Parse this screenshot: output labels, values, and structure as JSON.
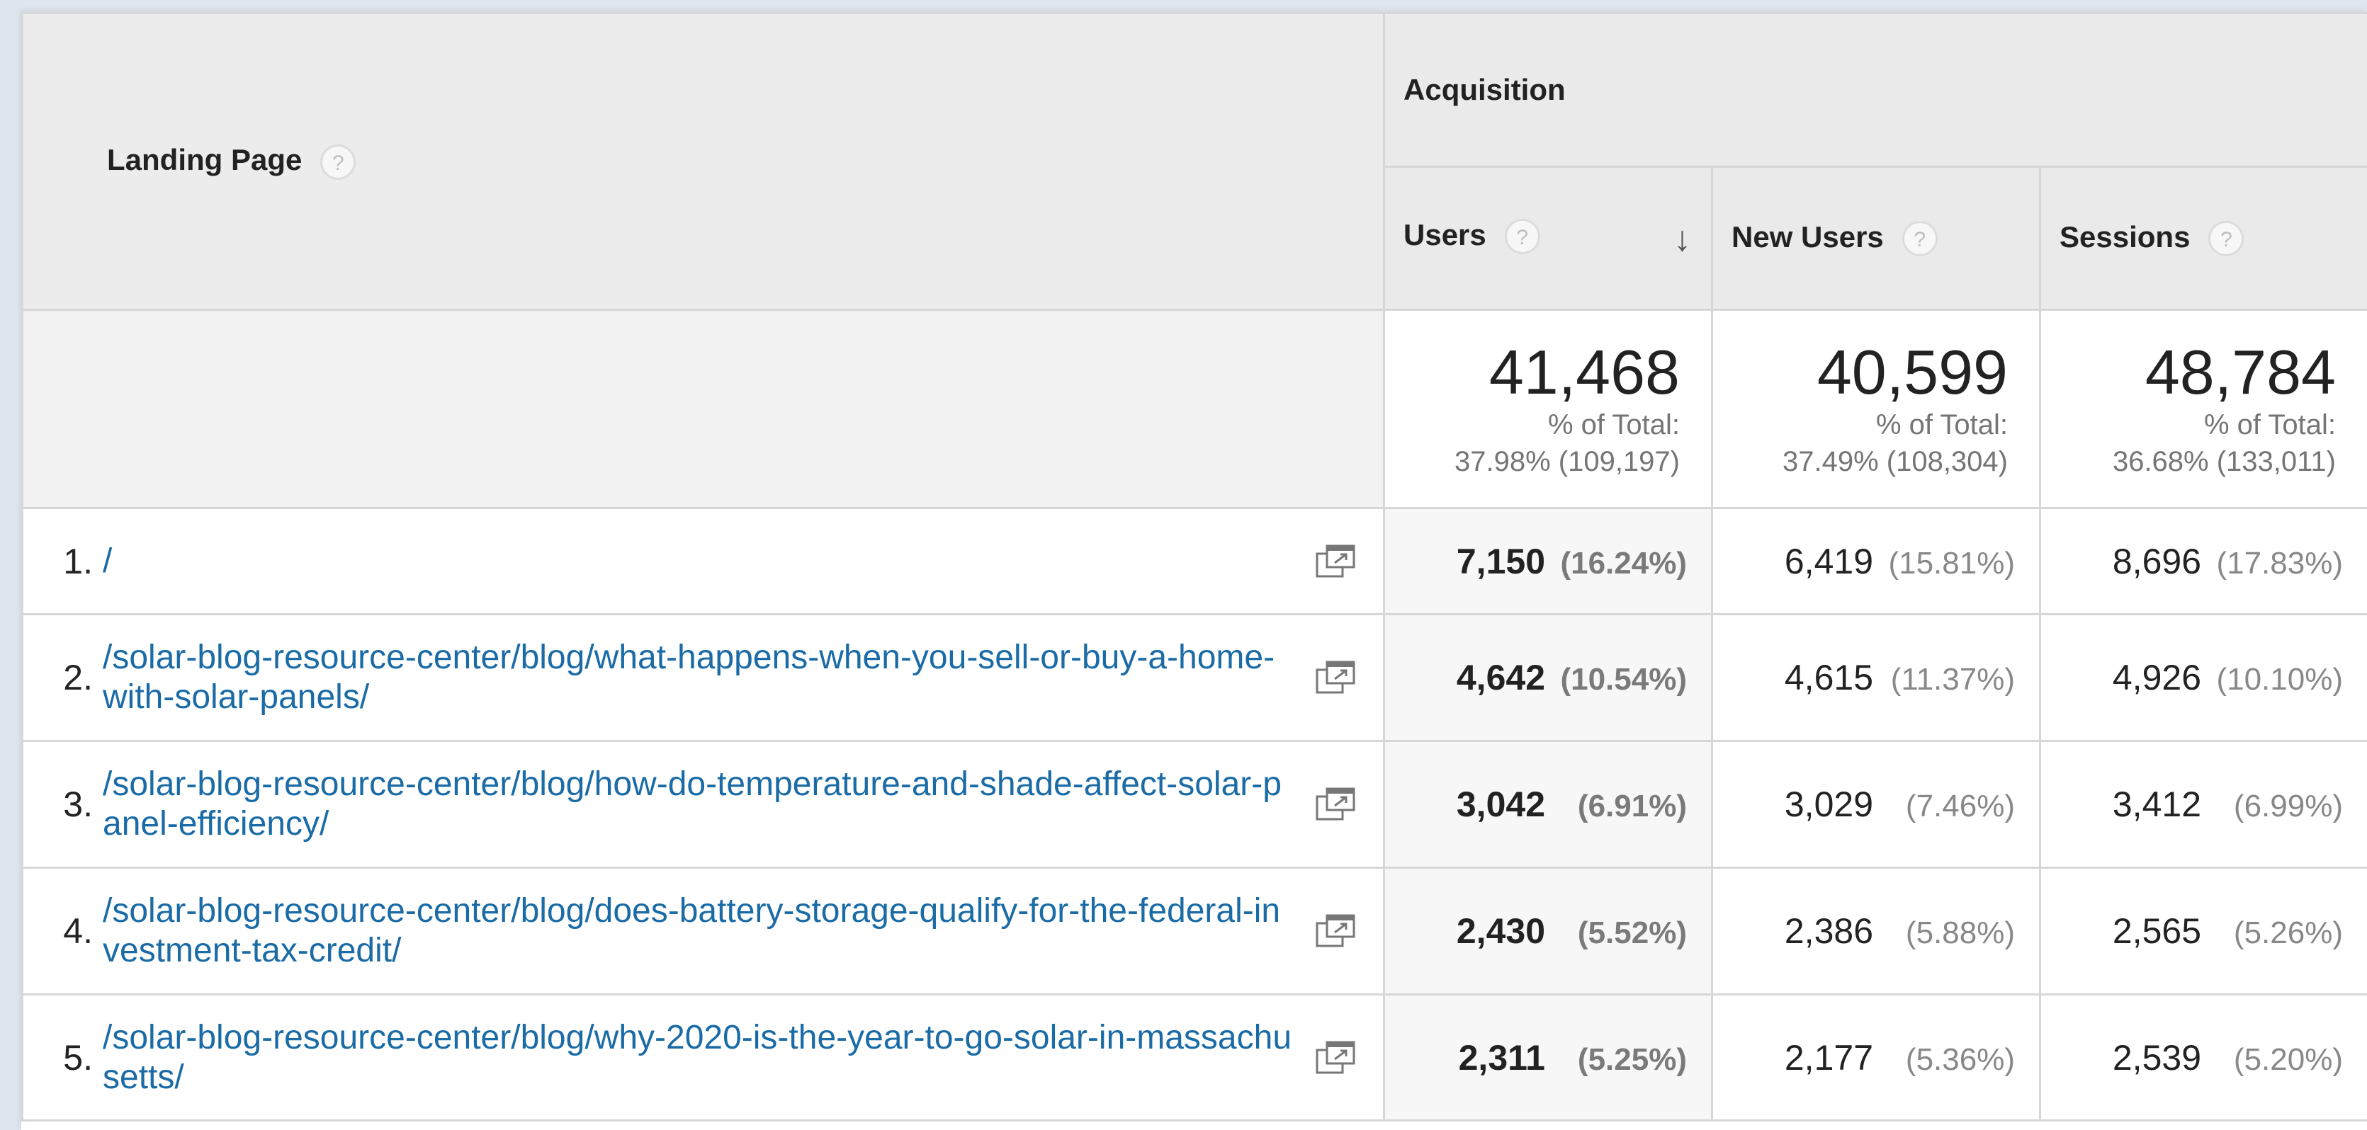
{
  "header": {
    "landing_page": "Landing Page",
    "acquisition": "Acquisition",
    "help": "?",
    "sort_arrow": "↓",
    "columns": {
      "users": "Users",
      "new_users": "New Users",
      "sessions": "Sessions"
    }
  },
  "totals": {
    "users": {
      "value": "41,468",
      "label": "% of Total:",
      "detail": "37.98% (109,197)"
    },
    "new_users": {
      "value": "40,599",
      "label": "% of Total:",
      "detail": "37.49% (108,304)"
    },
    "sessions": {
      "value": "48,784",
      "label": "% of Total:",
      "detail": "36.68% (133,011)"
    }
  },
  "rows": [
    {
      "num": "1.",
      "page": "/",
      "users": "7,150",
      "users_pct": "(16.24%)",
      "new_users": "6,419",
      "new_users_pct": "(15.81%)",
      "sessions": "8,696",
      "sessions_pct": "(17.83%)"
    },
    {
      "num": "2.",
      "page": "/solar-blog-resource-center/blog/what-happens-when-you-sell-or-buy-a-home-with-solar-panels/",
      "users": "4,642",
      "users_pct": "(10.54%)",
      "new_users": "4,615",
      "new_users_pct": "(11.37%)",
      "sessions": "4,926",
      "sessions_pct": "(10.10%)"
    },
    {
      "num": "3.",
      "page": "/solar-blog-resource-center/blog/how-do-temperature-and-shade-affect-solar-panel-efficiency/",
      "users": "3,042",
      "users_pct": "(6.91%)",
      "new_users": "3,029",
      "new_users_pct": "(7.46%)",
      "sessions": "3,412",
      "sessions_pct": "(6.99%)"
    },
    {
      "num": "4.",
      "page": "/solar-blog-resource-center/blog/does-battery-storage-qualify-for-the-federal-investment-tax-credit/",
      "users": "2,430",
      "users_pct": "(5.52%)",
      "new_users": "2,386",
      "new_users_pct": "(5.88%)",
      "sessions": "2,565",
      "sessions_pct": "(5.26%)"
    },
    {
      "num": "5.",
      "page": "/solar-blog-resource-center/blog/why-2020-is-the-year-to-go-solar-in-massachusetts/",
      "users": "2,311",
      "users_pct": "(5.25%)",
      "new_users": "2,177",
      "new_users_pct": "(5.36%)",
      "sessions": "2,539",
      "sessions_pct": "(5.20%)"
    }
  ],
  "icons": {
    "help": "question-mark-circle-icon",
    "sort": "arrow-down-icon",
    "external": "open-in-new-window-icon"
  },
  "colors": {
    "link": "#1a6ba6",
    "header_bg": "#eaeaea",
    "border": "#d7d7d7"
  }
}
